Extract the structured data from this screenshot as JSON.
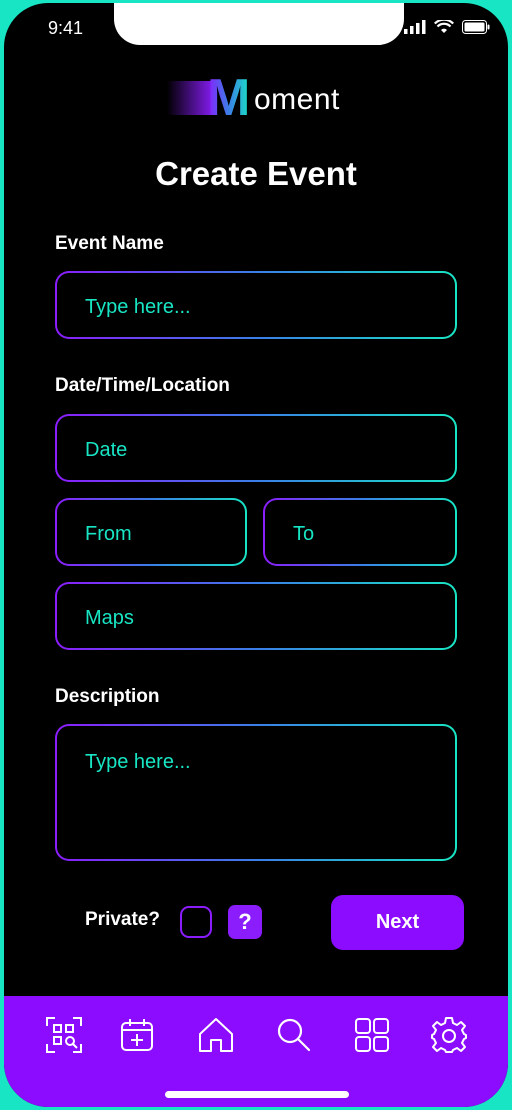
{
  "status_bar": {
    "time": "9:41"
  },
  "brand": {
    "logo_mark": "M",
    "logo_rest": "oment"
  },
  "page": {
    "title": "Create Event"
  },
  "form": {
    "event_name_label": "Event Name",
    "event_name_placeholder": "Type here...",
    "datetime_label": "Date/Time/Location",
    "date_placeholder": "Date",
    "from_placeholder": "From",
    "to_placeholder": "To",
    "maps_placeholder": "Maps",
    "description_label": "Description",
    "description_placeholder": "Type here...",
    "private_label": "Private?",
    "private_checked": false,
    "help_label": "?",
    "next_label": "Next"
  },
  "tab_bar": {
    "items": [
      {
        "icon": "qr-scan-icon"
      },
      {
        "icon": "calendar-add-icon"
      },
      {
        "icon": "home-icon"
      },
      {
        "icon": "search-icon"
      },
      {
        "icon": "grid-icon"
      },
      {
        "icon": "gear-icon"
      }
    ]
  },
  "colors": {
    "accent_purple": "#8b0cff",
    "accent_teal": "#18e5c4",
    "background": "#000000",
    "frame": "#18e5c4"
  }
}
